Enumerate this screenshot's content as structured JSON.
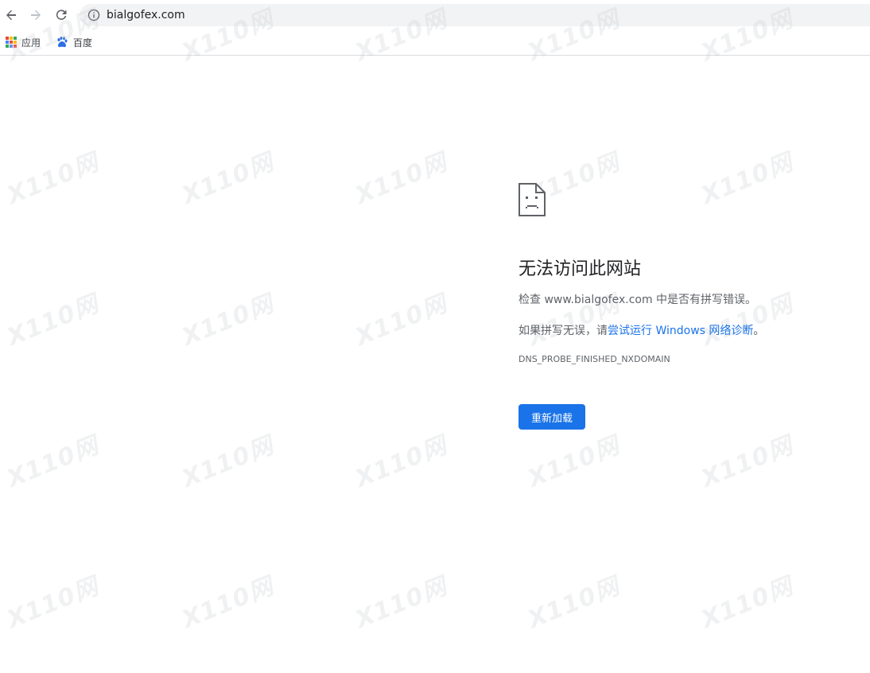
{
  "browser": {
    "url": "bialgofex.com",
    "bookmarks": [
      {
        "label": "应用",
        "icon": "apps-grid-icon"
      },
      {
        "label": "百度",
        "icon": "baidu-paw-icon"
      }
    ]
  },
  "error": {
    "title": "无法访问此网站",
    "check_prefix": "检查 ",
    "check_domain": "www.bialgofex.com",
    "check_suffix": " 中是否有拼写错误。",
    "hint_prefix": "如果拼写无误，请",
    "hint_link": "尝试运行 Windows 网络诊断",
    "hint_suffix": "。",
    "code": "DNS_PROBE_FINISHED_NXDOMAIN",
    "reload_label": "重新加载"
  },
  "watermark": {
    "text": "X110网"
  },
  "colors": {
    "accent": "#1a73e8",
    "omnibox_bg": "#f1f3f4",
    "title_text": "#202124",
    "body_text": "#5f6368"
  }
}
